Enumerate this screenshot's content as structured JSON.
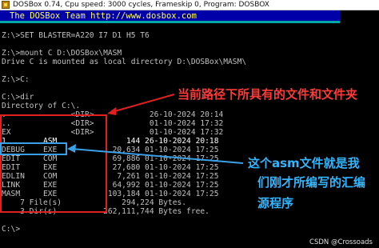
{
  "window": {
    "title": "DOSBox 0.74, Cpu speed:    3000 cycles, Frameskip 0, Program:  DOSBOX",
    "icon": "dosbox-icon"
  },
  "banner": {
    "text": "The DOSBox Team http://www.dosbox.com"
  },
  "console": {
    "lines": [
      "Z:\\>SET BLASTER=A220 I7 D1 H5 T6",
      "",
      "Z:\\>mount C D:\\DOSBox\\MASM",
      "Drive C is mounted as local directory D:\\DOSBox\\MASM\\",
      "",
      "Z:\\>C:",
      "",
      "C:\\>dir",
      "Directory of C:\\.",
      ".              <DIR>            26-10-2024 20:14",
      "..             <DIR>            01-10-2024 17:32",
      "EX             <DIR>            01-10-2024 17:32",
      "1        ASM               144 26-10-2024 20:18",
      "DEBUG    EXE            20,634 01-10-2024 17:25",
      "EDIT     COM            69,886 01-10-2024 17:25",
      "EDIT     EXE            27,680 01-10-2024 17:25",
      "EDLIN    COM             7,261 01-10-2024 17:25",
      "LINK     EXE            64,992 01-10-2024 17:25",
      "MASM     EXE           103,184 01-10-2024 17:25",
      "    7 File(s)             294,224 Bytes.",
      "    3 Dir(s)          262,111,744 Bytes free.",
      "",
      "C:\\>"
    ]
  },
  "annotations": {
    "red_label": "当前路径下所具有的文件和文件夹",
    "blue_label_line1": "这个asm文件就是我",
    "blue_label_line2": "们刚才所编写的汇编",
    "blue_label_line3": "源程序",
    "red_color": "#e02020",
    "blue_color": "#3aa0e8"
  },
  "watermark": "CSDN @Crossoads"
}
